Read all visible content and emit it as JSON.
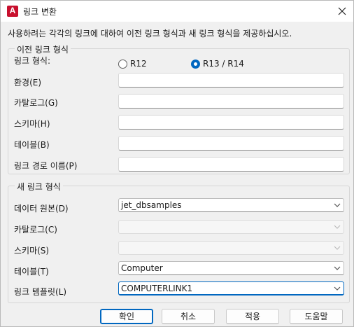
{
  "window": {
    "title": "링크 변환",
    "app_icon_letter": "A"
  },
  "description": "사용하려는 각각의 링크에 대하여 이전 링크 형식과 새 링크 형식을 제공하십시오.",
  "old_group": {
    "legend": "이전 링크 형식",
    "link_format_label": "링크 형식:",
    "radio_r12": {
      "label": "R12",
      "checked": false
    },
    "radio_r13": {
      "label": "R13 / R14",
      "checked": true
    },
    "environment": {
      "label": "환경(E)",
      "value": ""
    },
    "catalog": {
      "label": "카탈로그(G)",
      "value": ""
    },
    "schema": {
      "label": "스키마(H)",
      "value": ""
    },
    "table": {
      "label": "테이블(B)",
      "value": ""
    },
    "link_path": {
      "label": "링크 경로 이름(P)",
      "value": ""
    }
  },
  "new_group": {
    "legend": "새 링크 형식",
    "data_source": {
      "label": "데이터 원본(D)",
      "value": "jet_dbsamples"
    },
    "catalog": {
      "label": "카탈로그(C)",
      "value": ""
    },
    "schema": {
      "label": "스키마(S)",
      "value": ""
    },
    "table": {
      "label": "테이블(T)",
      "value": "Computer"
    },
    "link_template": {
      "label": "링크 템플릿(L)",
      "value": "COMPUTERLINK1"
    }
  },
  "buttons": {
    "ok": "확인",
    "cancel": "취소",
    "apply": "적용",
    "help": "도움말"
  },
  "colors": {
    "accent": "#0067c0",
    "app_icon": "#c8102e"
  }
}
